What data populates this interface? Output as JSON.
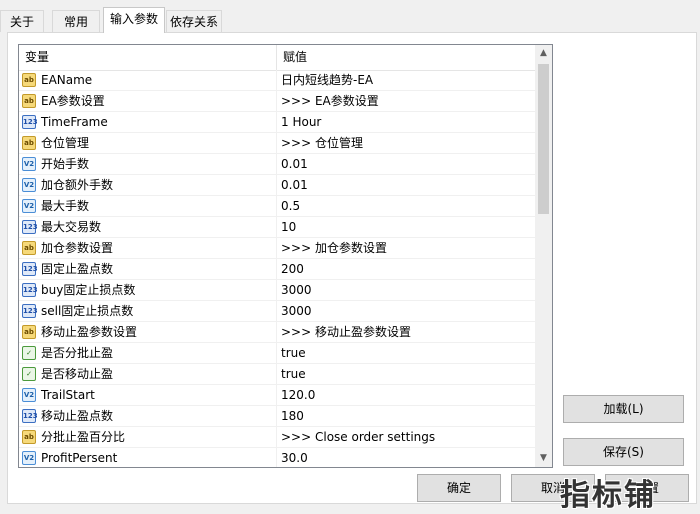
{
  "tabs": [
    {
      "label": "关于"
    },
    {
      "label": "常用"
    },
    {
      "label": "输入参数"
    },
    {
      "label": "依存关系"
    }
  ],
  "grid": {
    "col_variable": "变量",
    "col_value": "赋值",
    "rows": [
      {
        "icon": "ab",
        "variable": "EAName",
        "value": "日内短线趋势-EA"
      },
      {
        "icon": "ab",
        "variable": "EA参数设置",
        "value": ">>> EA参数设置"
      },
      {
        "icon": "123",
        "variable": "TimeFrame",
        "value": "1 Hour"
      },
      {
        "icon": "ab",
        "variable": "仓位管理",
        "value": ">>> 仓位管理"
      },
      {
        "icon": "v12",
        "variable": "开始手数",
        "value": "0.01"
      },
      {
        "icon": "v12",
        "variable": "加仓额外手数",
        "value": "0.01"
      },
      {
        "icon": "v12",
        "variable": "最大手数",
        "value": "0.5"
      },
      {
        "icon": "123",
        "variable": "最大交易数",
        "value": "10"
      },
      {
        "icon": "ab",
        "variable": "加仓参数设置",
        "value": ">>> 加仓参数设置"
      },
      {
        "icon": "123",
        "variable": "固定止盈点数",
        "value": "200"
      },
      {
        "icon": "123",
        "variable": "buy固定止损点数",
        "value": "3000"
      },
      {
        "icon": "123",
        "variable": "sell固定止损点数",
        "value": "3000"
      },
      {
        "icon": "ab",
        "variable": "移动止盈参数设置",
        "value": ">>> 移动止盈参数设置"
      },
      {
        "icon": "bool",
        "variable": "是否分批止盈",
        "value": "true"
      },
      {
        "icon": "bool",
        "variable": "是否移动止盈",
        "value": "true"
      },
      {
        "icon": "v12",
        "variable": "TrailStart",
        "value": "120.0"
      },
      {
        "icon": "123",
        "variable": "移动止盈点数",
        "value": "180"
      },
      {
        "icon": "ab",
        "variable": "分批止盈百分比",
        "value": ">>> Close order settings"
      },
      {
        "icon": "v12",
        "variable": "ProfitPersent",
        "value": "30.0"
      }
    ]
  },
  "icon_glyphs": {
    "ab": "ab",
    "123": "123",
    "v12": "V2",
    "bool": "✓"
  },
  "buttons": {
    "load": "加载(L)",
    "save": "保存(S)",
    "ok": "确定",
    "cancel": "取消",
    "reset": "重置"
  },
  "watermark": "指标铺"
}
